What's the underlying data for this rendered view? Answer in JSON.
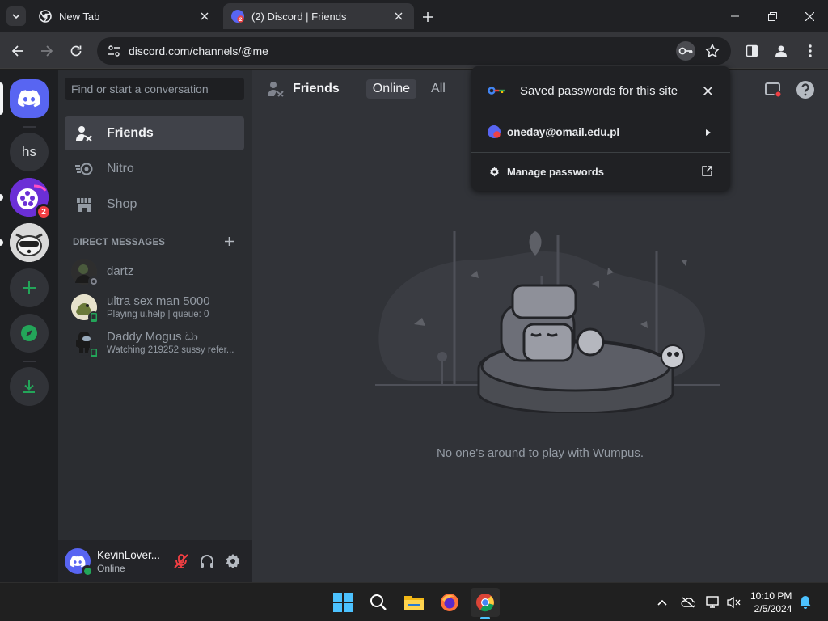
{
  "browser": {
    "tabs": [
      {
        "title": "New Tab",
        "icon": "chrome-icon",
        "active": false
      },
      {
        "title": "(2) Discord | Friends",
        "icon": "discord-favicon",
        "active": true,
        "badge": "2"
      }
    ],
    "url": "discord.com/channels/@me",
    "accent": "#8ab4f8"
  },
  "guilds": {
    "home_icon": "discord-logo-icon",
    "items": [
      {
        "label": "hs"
      },
      {
        "name": "movie-server-icon",
        "badge": "2"
      },
      {
        "name": "raccoon-server-icon"
      }
    ],
    "add_icon": "plus-icon",
    "explore_icon": "compass-icon",
    "download_icon": "download-icon"
  },
  "dm_panel": {
    "search_placeholder": "Find or start a conversation",
    "nav": [
      {
        "label": "Friends",
        "icon": "friends-icon",
        "selected": true
      },
      {
        "label": "Nitro",
        "icon": "nitro-icon"
      },
      {
        "label": "Shop",
        "icon": "shop-icon"
      }
    ],
    "direct_messages_header": "DIRECT MESSAGES",
    "dms": [
      {
        "name": "dartz",
        "activity": "",
        "status": "offline"
      },
      {
        "name": "ultra sex man 5000",
        "activity": "Playing u.help | queue: 0",
        "status": "mobile"
      },
      {
        "name": "Daddy Mogus ඩා",
        "activity": "Watching 219252 sussy refer...",
        "status": "mobile"
      }
    ]
  },
  "user_panel": {
    "username": "KevinLover...",
    "status": "Online"
  },
  "main": {
    "title": "Friends",
    "tabs": [
      "Online",
      "All"
    ],
    "active_tab": "Online",
    "empty_message": "No one's around to play with Wumpus."
  },
  "password_popup": {
    "title": "Saved passwords for this site",
    "account": "oneday@omail.edu.pl",
    "manage_label": "Manage passwords"
  },
  "taskbar": {
    "apps": [
      "start-icon",
      "search-icon",
      "file-explorer-icon",
      "firefox-icon",
      "chrome-icon"
    ],
    "time": "10:10 PM",
    "date": "2/5/2024"
  },
  "colors": {
    "blurple": "#5865f2",
    "green": "#23a559",
    "red": "#f23f43"
  }
}
